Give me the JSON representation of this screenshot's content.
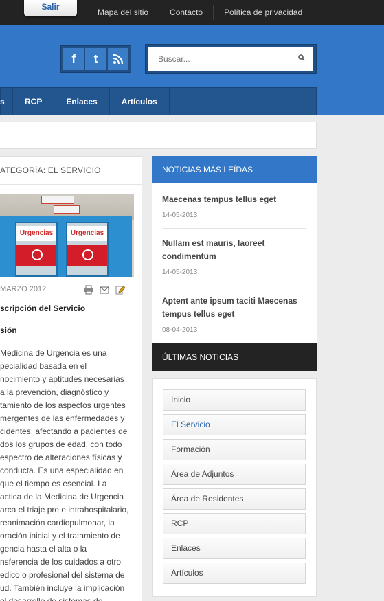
{
  "topbar": {
    "logout_label": "Salir",
    "links": [
      "Mapa del sitio",
      "Contacto",
      "Política de privacidad"
    ]
  },
  "header": {
    "social_icons": [
      "facebook-icon",
      "twitter-icon",
      "rss-icon"
    ],
    "search": {
      "placeholder": "Buscar...",
      "value": ""
    },
    "nav": [
      "s",
      "RCP",
      "Enlaces",
      "Artículos"
    ],
    "colors": {
      "brand_blue": "#3277c8",
      "nav_blue": "#23558f",
      "dark": "#232323"
    }
  },
  "article": {
    "category_title": "ATEGORÍA: EL SERVICIO",
    "photo_signs": [
      "Urgencias",
      "Urgencias"
    ],
    "date": "MARZO 2012",
    "title": "scripción del Servicio",
    "subtitle": "sión",
    "body_lines": [
      "Medicina de Urgencia es una",
      "pecialidad basada en el",
      "nocimiento y aptitudes necesarias",
      "a la prevención, diagnóstico y",
      "tamiento de los aspectos urgentes",
      "mergentes de las enfermedades y",
      "cidentes, afectando a pacientes de",
      "dos los grupos de edad, con todo",
      "espectro de alteraciones físicas y",
      "conducta. Es una especialidad en",
      "que el tiempo es esencial. La",
      "actica de la Medicina de Urgencia",
      "arca el triaje pre e intrahospitalario,",
      "reanimación cardiopulmonar, la",
      "oración inicial y el tratamiento de",
      "gencia hasta el alta o la",
      "nsferencia de los cuidados a otro",
      "edico o profesional del sistema de",
      "ud. También incluye la implicación",
      "el desarrollo de sistemas de"
    ]
  },
  "sidebar": {
    "popular_title": "NOTICIAS MÁS LEÍDAS",
    "popular": [
      {
        "title": "Maecenas tempus tellus eget",
        "date": "14-05-2013"
      },
      {
        "title": "Nullam est mauris, laoreet condimentum",
        "date": "14-05-2013"
      },
      {
        "title": "Aptent ante ipsum taciti Maecenas tempus tellus eget",
        "date": "08-04-2013"
      }
    ],
    "latest_title": "ÚLTIMAS NOTICIAS",
    "menu": [
      "Inicio",
      "El Servicio",
      "Formación",
      "Área de Adjuntos",
      "Área de Residentes",
      "RCP",
      "Enlaces",
      "Artículos"
    ],
    "menu_active": "El Servicio"
  }
}
